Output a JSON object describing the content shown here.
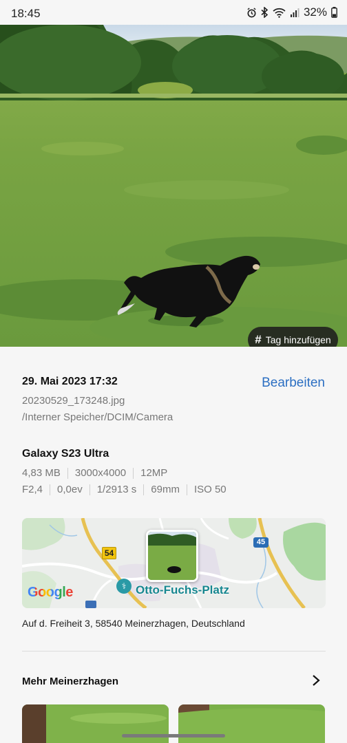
{
  "status": {
    "time": "18:45",
    "battery": "32%",
    "icons": [
      "alarm-icon",
      "bluetooth-icon",
      "wifi-icon",
      "signal-icon",
      "battery-icon"
    ]
  },
  "photo": {
    "description_icon": "photo-image",
    "tag_button": {
      "icon": "#",
      "label": "Tag hinzufügen"
    }
  },
  "details": {
    "date": "29. Mai 2023 17:32",
    "edit_label": "Bearbeiten",
    "filename": "20230529_173248.jpg",
    "path": "/Interner Speicher/DCIM/Camera",
    "device": "Galaxy S23 Ultra",
    "row1": [
      "4,83 MB",
      "3000x4000",
      "12MP"
    ],
    "row2": [
      "F2,4",
      "0,0ev",
      "1/2913 s",
      "69mm",
      "ISO 50"
    ]
  },
  "map": {
    "road_a": "54",
    "road_b": "45",
    "place": "Otto-Fuchs-Platz",
    "google": "Google",
    "address": "Auf d. Freiheit 3, 58540 Meinerzhagen, Deutschland"
  },
  "more": {
    "title": "Mehr Meinerzhagen"
  },
  "colors": {
    "accent": "#2c6fc2",
    "background": "#f6f6f6"
  }
}
